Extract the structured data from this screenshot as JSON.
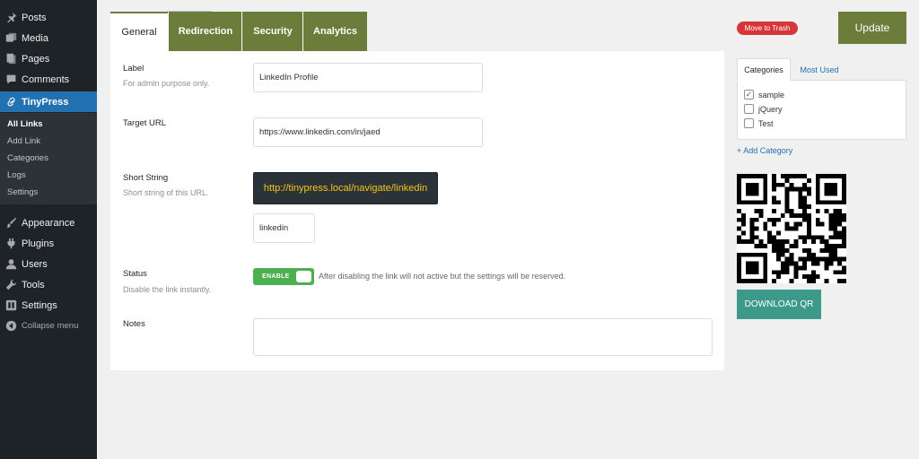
{
  "sidebar": {
    "items": [
      {
        "label": "Posts",
        "icon": "pin-icon"
      },
      {
        "label": "Media",
        "icon": "media-icon"
      },
      {
        "label": "Pages",
        "icon": "pages-icon"
      },
      {
        "label": "Comments",
        "icon": "comment-icon"
      },
      {
        "label": "TinyPress",
        "icon": "link-icon",
        "active": true
      }
    ],
    "submenu": [
      "All Links",
      "Add Link",
      "Categories",
      "Logs",
      "Settings"
    ],
    "bottom_items": [
      {
        "label": "Appearance",
        "icon": "brush-icon"
      },
      {
        "label": "Plugins",
        "icon": "plugin-icon"
      },
      {
        "label": "Users",
        "icon": "user-icon"
      },
      {
        "label": "Tools",
        "icon": "wrench-icon"
      },
      {
        "label": "Settings",
        "icon": "settings-icon"
      }
    ],
    "collapse_label": "Collapse menu"
  },
  "tabs": [
    "General",
    "Redirection",
    "Security",
    "Analytics"
  ],
  "form": {
    "label": {
      "title": "Label",
      "desc": "For admin purpose only.",
      "value": "LinkedIn Profile"
    },
    "target": {
      "title": "Target URL",
      "value": "https://www.linkedin.com/in/jaed"
    },
    "short": {
      "title": "Short String",
      "desc": "Short string of this URL.",
      "url": "http://tinypress.local/navigate/linkedin",
      "value": "linkedin"
    },
    "status": {
      "title": "Status",
      "desc": "Disable the link instantly.",
      "toggle_label": "ENABLE",
      "help": "After disabling the link will not active but the settings will be reserved."
    },
    "notes": {
      "title": "Notes",
      "value": ""
    }
  },
  "actions": {
    "trash": "Move to Trash",
    "update": "Update"
  },
  "categories": {
    "tabs": [
      "Categories",
      "Most Used"
    ],
    "items": [
      {
        "label": "sample",
        "checked": true
      },
      {
        "label": "jQuery",
        "checked": false
      },
      {
        "label": "Test",
        "checked": false
      }
    ],
    "add_label": "+ Add Category"
  },
  "qr": {
    "download_label": "DOWNLOAD QR"
  },
  "colors": {
    "olive": "#6b7c3b",
    "wp_blue": "#2271b1",
    "danger": "#d63638",
    "teal": "#3d9a8b",
    "toggle_green": "#4caf50"
  }
}
